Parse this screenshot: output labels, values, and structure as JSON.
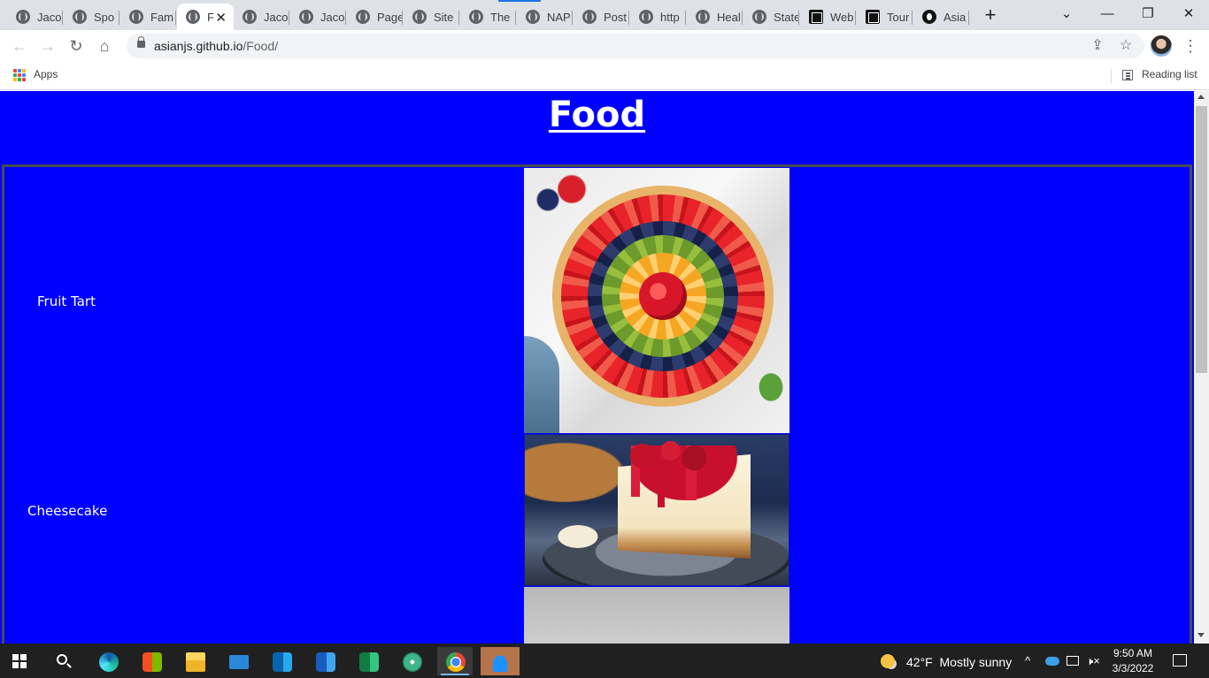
{
  "browser": {
    "tabs": [
      {
        "label": "Jaco",
        "favicon": "globe-icon"
      },
      {
        "label": "Spo",
        "favicon": "globe-icon"
      },
      {
        "label": "Fam",
        "favicon": "globe-icon"
      },
      {
        "label": "F",
        "favicon": "globe-icon",
        "active": true
      },
      {
        "label": "Jaco",
        "favicon": "globe-icon"
      },
      {
        "label": "Jaco",
        "favicon": "globe-icon"
      },
      {
        "label": "Page",
        "favicon": "globe-icon"
      },
      {
        "label": "Site",
        "favicon": "globe-icon"
      },
      {
        "label": "The",
        "favicon": "globe-icon"
      },
      {
        "label": "NAP",
        "favicon": "globe-icon"
      },
      {
        "label": "Post",
        "favicon": "globe-icon"
      },
      {
        "label": "http",
        "favicon": "globe-icon"
      },
      {
        "label": "Heal",
        "favicon": "globe-icon"
      },
      {
        "label": "State",
        "favicon": "globe-icon"
      },
      {
        "label": "Web",
        "favicon": "square-logo-icon"
      },
      {
        "label": "Tour",
        "favicon": "square-logo-icon"
      },
      {
        "label": "Asia",
        "favicon": "github-icon"
      }
    ],
    "close_tab_glyph": "✕",
    "new_tab_glyph": "+",
    "window_controls": {
      "dropdown": "⌄",
      "minimize": "—",
      "restore": "❐",
      "close": "✕"
    },
    "nav": {
      "back": "←",
      "forward": "→",
      "reload": "↻",
      "home": "⌂"
    },
    "url": {
      "host": "asianjs.github.io",
      "path": "/Food/"
    },
    "omnibox_icons": {
      "share": "⇪",
      "bookmark": "☆"
    },
    "menu_glyph": "⋮",
    "bookmarks": {
      "apps_label": "Apps",
      "reading_list_label": "Reading list"
    }
  },
  "page": {
    "title": "Food",
    "background_color": "#0000ff",
    "items": [
      {
        "name": "Fruit Tart",
        "image": "fruit-tart-photo"
      },
      {
        "name": "Cheesecake",
        "image": "cheesecake-photo"
      },
      {
        "name": "",
        "image": "third-food-photo"
      }
    ]
  },
  "taskbar": {
    "apps": [
      "start-icon",
      "search-icon",
      "edge-icon",
      "store-icon",
      "file-explorer-icon",
      "mail-icon",
      "outlook-icon",
      "word-icon",
      "excel-icon",
      "atom-icon",
      "chrome-icon",
      "onedrive-icon"
    ],
    "weather": {
      "temp": "42°F",
      "condition": "Mostly sunny"
    },
    "tray": {
      "chevron": "^",
      "volume": "🕨×"
    },
    "clock": {
      "time": "9:50 AM",
      "date": "3/3/2022"
    }
  }
}
